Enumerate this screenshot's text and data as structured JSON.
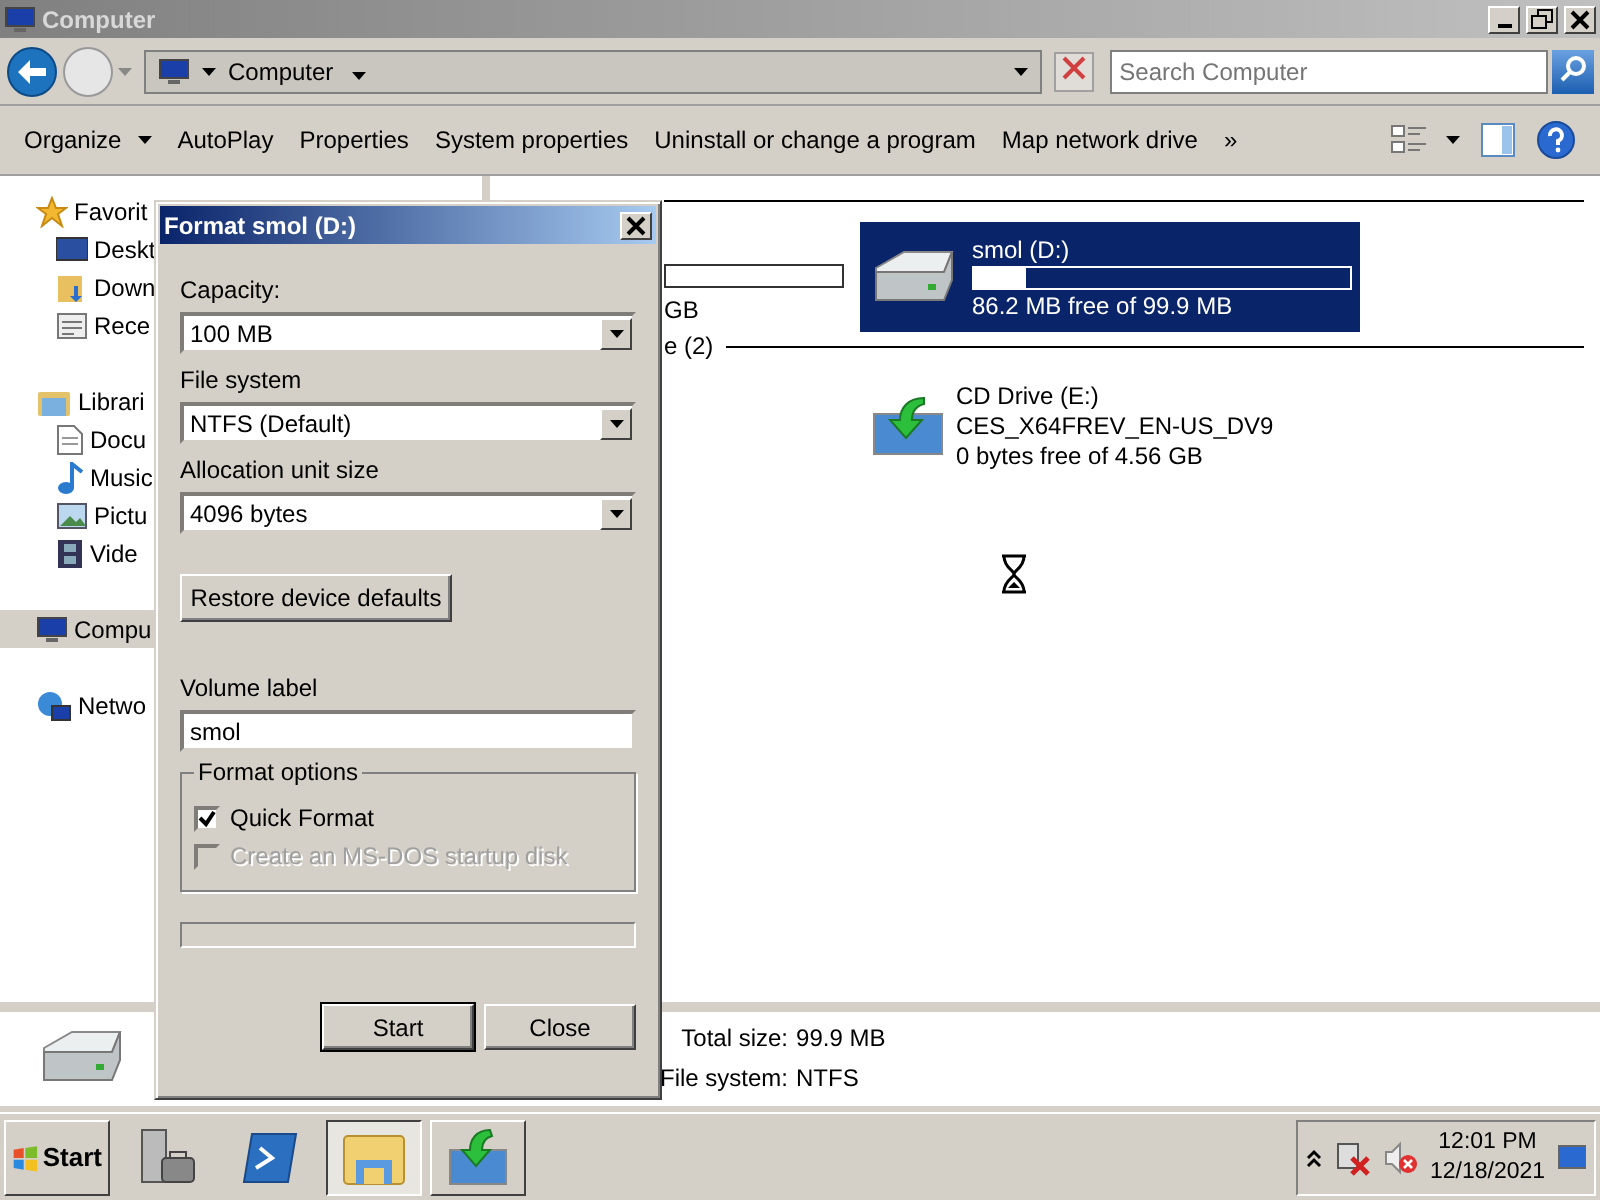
{
  "window": {
    "title": "Computer"
  },
  "address": {
    "path": "Computer"
  },
  "search": {
    "placeholder": "Search Computer"
  },
  "toolbar": [
    {
      "label": "Organize",
      "kind": "menu"
    },
    {
      "label": "AutoPlay",
      "kind": "plain"
    },
    {
      "label": "Properties",
      "kind": "plain"
    },
    {
      "label": "System properties",
      "kind": "plain"
    },
    {
      "label": "Uninstall or change a program",
      "kind": "plain"
    },
    {
      "label": "Map network drive",
      "kind": "plain"
    },
    {
      "label": "»",
      "kind": "plain"
    }
  ],
  "sidebar": [
    {
      "label": "Favorit",
      "selected": false,
      "children": [
        {
          "label": "Deskt",
          "selected": false
        },
        {
          "label": "Down",
          "selected": false
        },
        {
          "label": "Rece",
          "selected": false
        }
      ]
    },
    {
      "label": "Librari",
      "selected": false,
      "children": [
        {
          "label": "Docu",
          "selected": false
        },
        {
          "label": "Music",
          "selected": false
        },
        {
          "label": "Pictu",
          "selected": false
        },
        {
          "label": "Vide",
          "selected": false
        }
      ]
    },
    {
      "label": "Compu",
      "selected": true
    },
    {
      "label": "Netwo",
      "selected": false
    }
  ],
  "content": {
    "size_fragment": "GB",
    "group_fragment": "e (2)",
    "drives": [
      {
        "kind": "disk",
        "name": "smol (D:)",
        "selected": true,
        "level": 0.137,
        "free": "86.2 MB free of 99.9 MB"
      },
      {
        "kind": "cd",
        "name": "CD Drive (E:)",
        "label": "CES_X64FREV_EN-US_DV9",
        "selected": false,
        "free": "0 bytes free of 4.56 GB"
      }
    ]
  },
  "details": [
    {
      "label": "Total size:",
      "value": "99.9 MB"
    },
    {
      "label": "File system:",
      "value": "NTFS"
    }
  ],
  "dialog": {
    "title": "Format smol (D:)",
    "selects": [
      {
        "label": "Capacity:",
        "value": "100 MB"
      },
      {
        "label": "File system",
        "value": "NTFS (Default)"
      },
      {
        "label": "Allocation unit size",
        "value": "4096 bytes"
      }
    ],
    "restore_button": "Restore device defaults",
    "volume": {
      "label": "Volume label",
      "value": "smol"
    },
    "options": {
      "title": "Format options",
      "items": [
        {
          "label": "Quick Format",
          "checked": true,
          "disabled": false
        },
        {
          "label": "Create an MS-DOS startup disk",
          "checked": false,
          "disabled": true
        }
      ]
    },
    "progress": {
      "level": 0
    },
    "buttons": [
      {
        "label": "Start",
        "default": true
      },
      {
        "label": "Close",
        "default": false
      }
    ]
  },
  "taskbar": {
    "start": "Start",
    "items": [
      {
        "kind": "pinned",
        "selected": false
      },
      {
        "kind": "pinned",
        "selected": false
      },
      {
        "kind": "window",
        "selected": true
      },
      {
        "kind": "window",
        "selected": false
      }
    ]
  },
  "tray": {
    "time": "12:01 PM",
    "date": "12/18/2021"
  }
}
